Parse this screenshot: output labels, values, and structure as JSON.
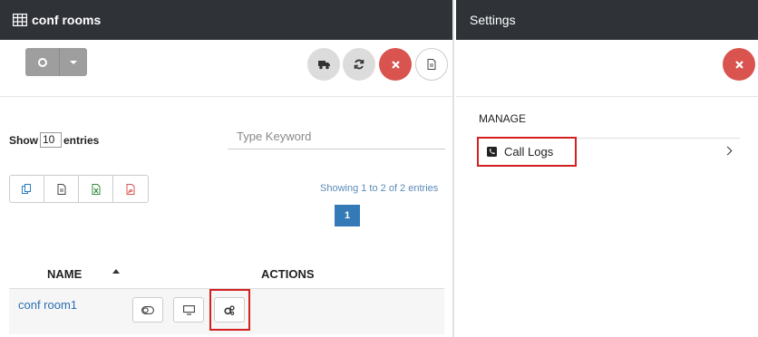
{
  "left_panel": {
    "title": "conf rooms",
    "title_icon": "table-icon"
  },
  "toolbar": {
    "split_icon": "circle-icon",
    "buttons": [
      {
        "name": "truck-icon"
      },
      {
        "name": "refresh-icon"
      },
      {
        "name": "close-icon"
      },
      {
        "name": "document-icon"
      }
    ]
  },
  "list": {
    "show_label": "Show",
    "show_value": "10",
    "entries_label": "entries",
    "search_placeholder": "Type Keyword",
    "export_icons": [
      "copy-icon",
      "csv-icon",
      "excel-icon",
      "pdf-icon"
    ],
    "info": "Showing 1 to 2 of 2 entries",
    "page": "1"
  },
  "table": {
    "headers": [
      "NAME",
      "ACTIONS"
    ],
    "rows": [
      {
        "name": "conf room1",
        "actions": [
          "toggle-icon",
          "monitor-icon",
          "settings-cogs-icon"
        ]
      }
    ]
  },
  "right_panel": {
    "title": "Settings",
    "section": "MANAGE",
    "item": "Call Logs",
    "item_icon": "phone-icon"
  },
  "colors": {
    "header_bg": "#2f3338",
    "danger": "#d9534f",
    "primary": "#337ab7",
    "highlight": "#d42020"
  }
}
